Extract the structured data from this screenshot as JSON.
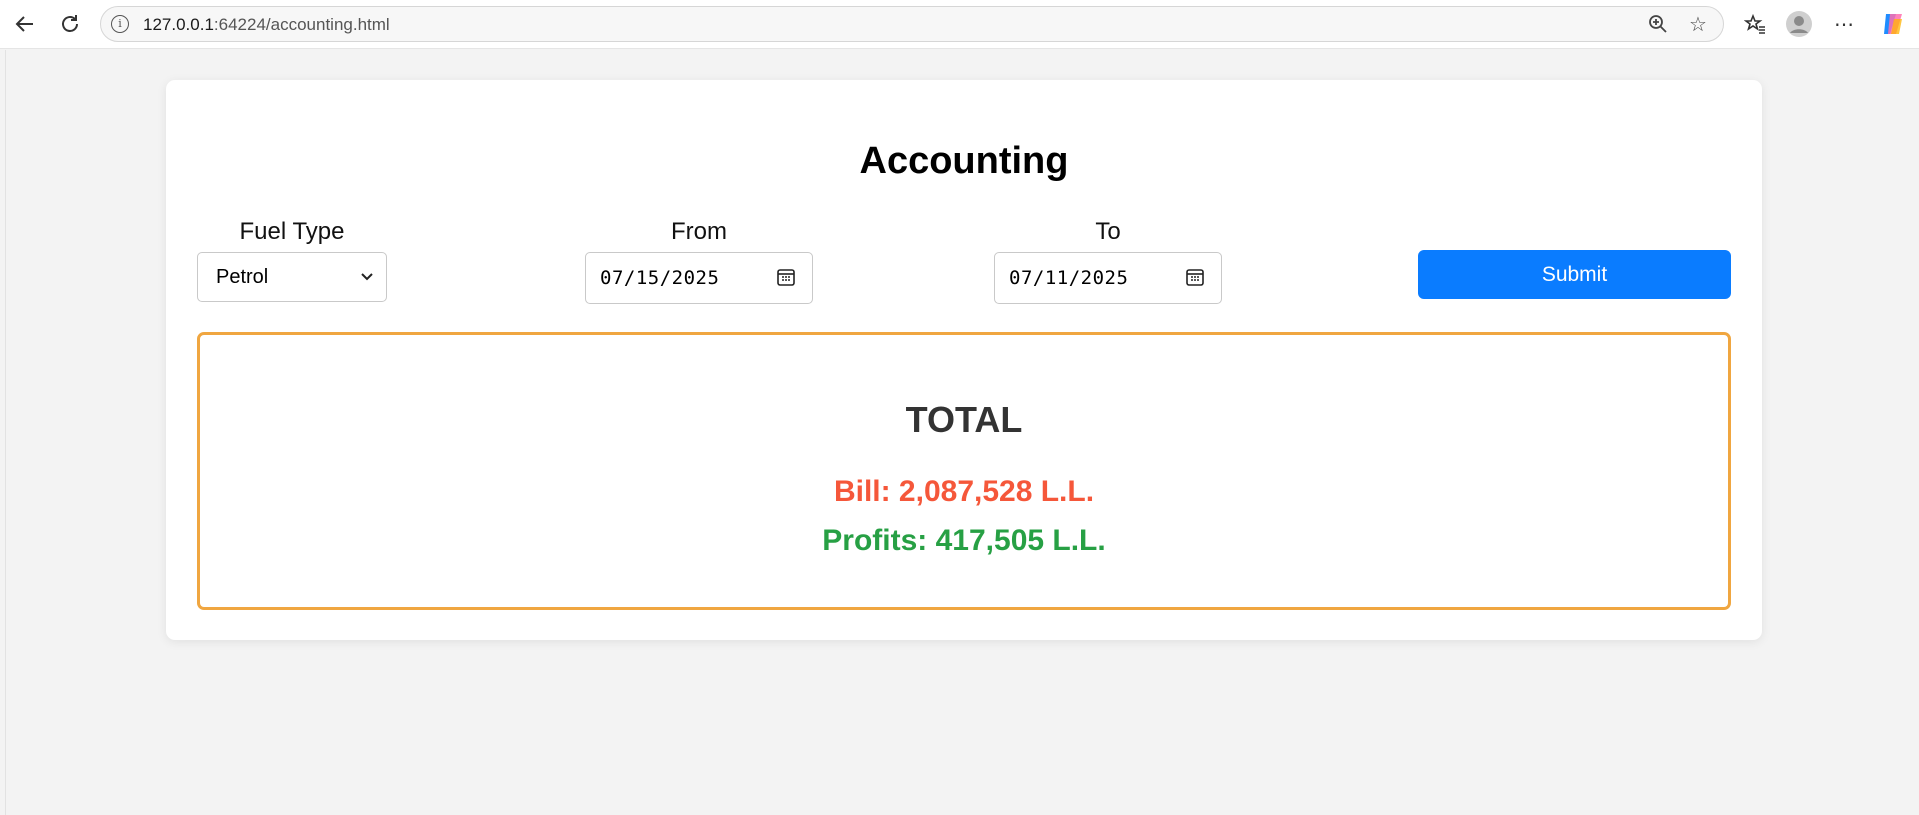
{
  "browser": {
    "url_host": "127.0.0.1",
    "url_rest": ":64224/accounting.html",
    "icons": [
      "back-icon",
      "refresh-icon",
      "info-icon",
      "zoom-icon",
      "favorite-star-icon",
      "favorites-icon",
      "profile-icon",
      "more-icon",
      "copilot-icon"
    ]
  },
  "page": {
    "title": "Accounting",
    "fuel_type": {
      "label": "Fuel Type",
      "selected": "Petrol"
    },
    "from": {
      "label": "From",
      "value": "07/15/2025"
    },
    "to": {
      "label": "To",
      "value": "07/11/2025"
    },
    "submit_label": "Submit",
    "total": {
      "heading": "TOTAL",
      "bill": "Bill: 2,087,528 L.L.",
      "profits": "Profits: 417,505 L.L."
    }
  },
  "colors": {
    "accent": "#0a7cff",
    "bill": "#f5573a",
    "profits": "#27a044",
    "box_border": "#f0a640"
  }
}
